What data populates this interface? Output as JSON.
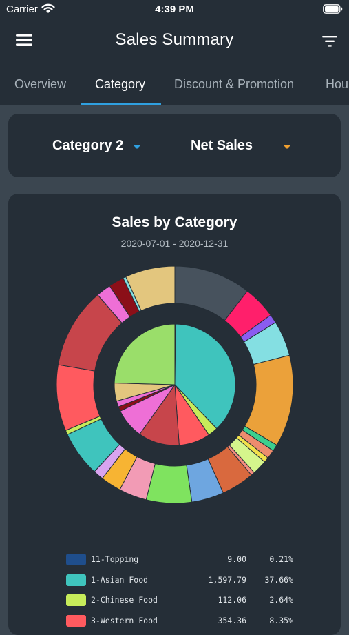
{
  "status_bar": {
    "carrier": "Carrier",
    "time": "4:39 PM"
  },
  "header": {
    "title": "Sales Summary",
    "menu_icon": "hamburger-menu-icon",
    "filter_icon": "filter-icon"
  },
  "tabs": [
    {
      "label": "Overview",
      "active": false
    },
    {
      "label": "Category",
      "active": true
    },
    {
      "label": "Discount & Promotion",
      "active": false
    },
    {
      "label": "Hou",
      "active": false
    }
  ],
  "filters": {
    "category": {
      "label": "Category 2",
      "caret_color": "#2fa0e0"
    },
    "metric": {
      "label": "Net Sales",
      "caret_color": "#f0a030"
    }
  },
  "chart_title": "Sales by Category",
  "chart_subtitle": "2020-07-01 - 2020-12-31",
  "legend": [
    {
      "name": "11-Topping",
      "value": "9.00",
      "pct": "0.21%",
      "color": "#1f4e8c"
    },
    {
      "name": "1-Asian Food",
      "value": "1,597.79",
      "pct": "37.66%",
      "color": "#3fc4bd"
    },
    {
      "name": "2-Chinese Food",
      "value": "112.06",
      "pct": "2.64%",
      "color": "#c7ec5a"
    },
    {
      "name": "3-Western Food",
      "value": "354.36",
      "pct": "8.35%",
      "color": "#ff5a5f"
    }
  ],
  "chart_data": {
    "type": "pie",
    "title": "Sales by Category",
    "subtitle": "2020-07-01 - 2020-12-31",
    "inner_pie": [
      {
        "label": "11-Topping",
        "value": 9.0,
        "pct": 0.21,
        "color": "#1f4e8c"
      },
      {
        "label": "1-Asian Food",
        "value": 1597.79,
        "pct": 37.66,
        "color": "#3fc4bd"
      },
      {
        "label": "2-Chinese Food",
        "value": 112.06,
        "pct": 2.64,
        "color": "#c7ec5a"
      },
      {
        "label": "3-Western Food",
        "value": 354.36,
        "pct": 8.35,
        "color": "#ff5a5f"
      },
      {
        "label": "",
        "value": null,
        "pct": 11.0,
        "color": "#c7454b"
      },
      {
        "label": "",
        "value": null,
        "pct": 8.0,
        "color": "#ee6fd6"
      },
      {
        "label": "",
        "value": null,
        "pct": 1.2,
        "color": "#8b0f18"
      },
      {
        "label": "",
        "value": null,
        "pct": 1.6,
        "color": "#ee6fd6"
      },
      {
        "label": "",
        "value": null,
        "pct": 4.8,
        "color": "#e3c67e"
      },
      {
        "label": "",
        "value": null,
        "pct": 24.55,
        "color": "#9ade6a"
      }
    ],
    "outer_ring": [
      {
        "pct": 10.5,
        "color": "#47525d"
      },
      {
        "pct": 4.5,
        "color": "#ff1f6b"
      },
      {
        "pct": 1.2,
        "color": "#8a5cf0"
      },
      {
        "pct": 4.8,
        "color": "#84dfe2"
      },
      {
        "pct": 12.5,
        "color": "#eba13a"
      },
      {
        "pct": 0.9,
        "color": "#3ccf8e"
      },
      {
        "pct": 1.2,
        "color": "#ed8c6e"
      },
      {
        "pct": 0.7,
        "color": "#f2e04a"
      },
      {
        "pct": 2.0,
        "color": "#d5f58c"
      },
      {
        "pct": 0.5,
        "color": "#f28b80"
      },
      {
        "pct": 4.5,
        "color": "#d9693e"
      },
      {
        "pct": 4.4,
        "color": "#6ea6e0"
      },
      {
        "pct": 6.2,
        "color": "#7fe35f"
      },
      {
        "pct": 3.8,
        "color": "#f29bb5"
      },
      {
        "pct": 2.8,
        "color": "#f7b433"
      },
      {
        "pct": 1.4,
        "color": "#d9a4f0"
      },
      {
        "pct": 6.2,
        "color": "#3fc4bd"
      },
      {
        "pct": 0.6,
        "color": "#c7ec5a"
      },
      {
        "pct": 9.0,
        "color": "#ff5a5f"
      },
      {
        "pct": 11.0,
        "color": "#c7454b"
      },
      {
        "pct": 2.0,
        "color": "#ee6fd6"
      },
      {
        "pct": 2.1,
        "color": "#8b0f18"
      },
      {
        "pct": 0.4,
        "color": "#84dfe2"
      },
      {
        "pct": 6.8,
        "color": "#e3c67e"
      }
    ]
  }
}
